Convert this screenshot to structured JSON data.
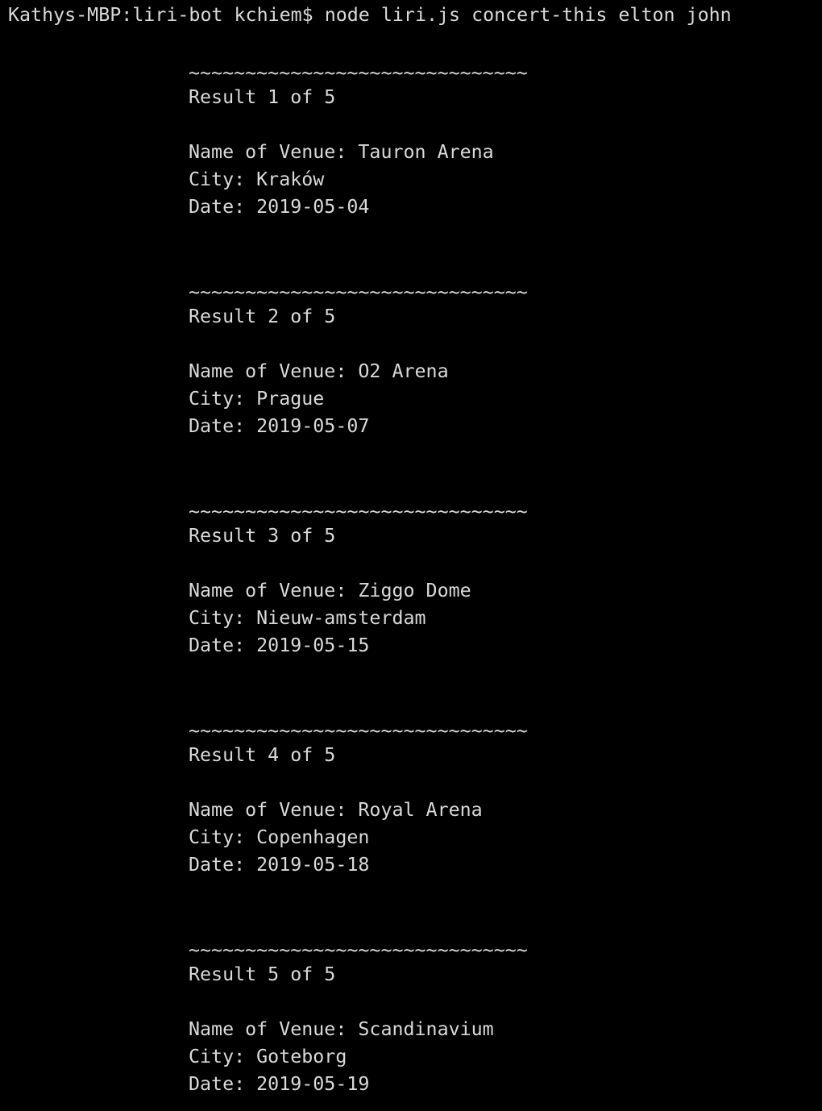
{
  "terminal": {
    "prompt": "Kathys-MBP:liri-bot kchiem$",
    "command": "node liri.js concert-this elton john",
    "separator": "~~~~~~~~~~~~~~~~~~~~~~~~~~~~~~",
    "results": [
      {
        "header": "Result 1 of 5",
        "venue": "Name of Venue: Tauron Arena",
        "city": "City: Kraków",
        "date": "Date: 2019-05-04"
      },
      {
        "header": "Result 2 of 5",
        "venue": "Name of Venue: O2 Arena",
        "city": "City: Prague",
        "date": "Date: 2019-05-07"
      },
      {
        "header": "Result 3 of 5",
        "venue": "Name of Venue: Ziggo Dome",
        "city": "City: Nieuw-amsterdam",
        "date": "Date: 2019-05-15"
      },
      {
        "header": "Result 4 of 5",
        "venue": "Name of Venue: Royal Arena",
        "city": "City: Copenhagen",
        "date": "Date: 2019-05-18"
      },
      {
        "header": "Result 5 of 5",
        "venue": "Name of Venue: Scandinavium",
        "city": "City: Goteborg",
        "date": "Date: 2019-05-19"
      }
    ]
  },
  "colors": {
    "background": "#000000",
    "text": "#d9d9d9"
  }
}
